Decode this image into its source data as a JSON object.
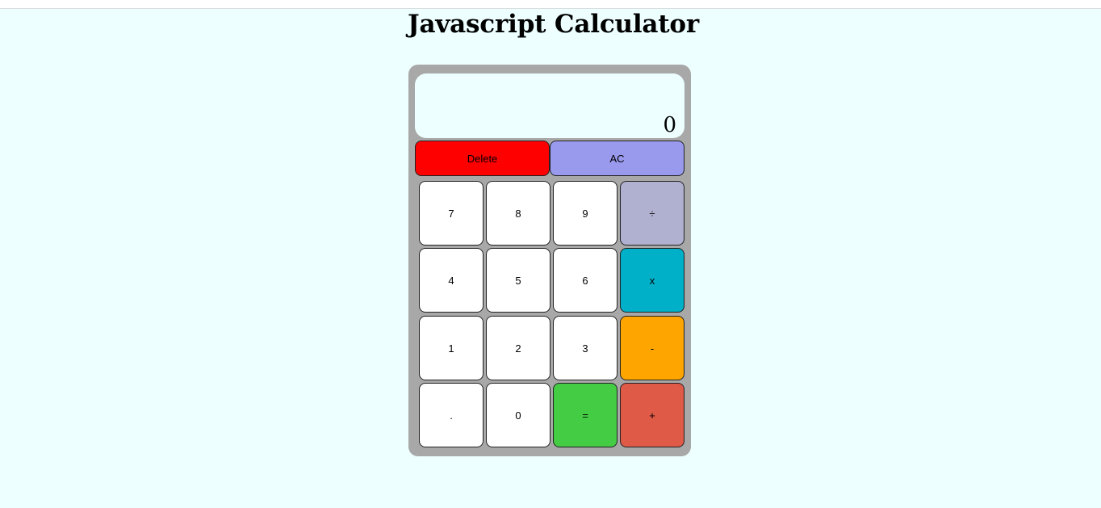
{
  "header": {
    "title": "Javascript Calculator"
  },
  "display": {
    "value": "0"
  },
  "controls": {
    "delete_label": "Delete",
    "clear_label": "AC"
  },
  "keys": {
    "seven": "7",
    "eight": "8",
    "nine": "9",
    "divide": "÷",
    "four": "4",
    "five": "5",
    "six": "6",
    "multiply": "x",
    "one": "1",
    "two": "2",
    "three": "3",
    "subtract": "-",
    "decimal": ".",
    "zero": "0",
    "equals": "=",
    "add": "+"
  },
  "colors": {
    "page_background": "#eeffff",
    "calculator_body": "#a8a8a8",
    "delete": "#ff0000",
    "clear": "#9999ee",
    "divide": "#b0b0d0",
    "multiply": "#00b0c8",
    "subtract": "#ffa500",
    "add": "#e05a48",
    "equals": "#44cc44",
    "digit": "#ffffff"
  }
}
